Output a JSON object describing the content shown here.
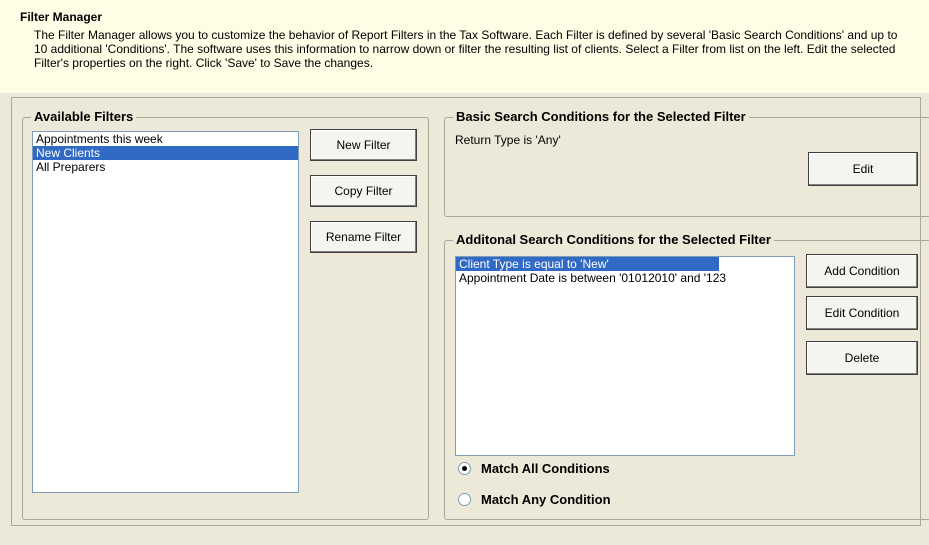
{
  "header": {
    "title": "Filter Manager",
    "description": "The Filter Manager allows you to customize the behavior of Report Filters in the Tax Software. Each Filter is defined by several 'Basic Search Conditions' and up to 10 additional 'Conditions'. The software uses this information to narrow down or filter the resulting list of clients. Select a Filter from list on the left. Edit the selected Filter's properties on the right. Click 'Save' to Save the changes."
  },
  "available_filters": {
    "title": "Available Filters",
    "items": [
      {
        "label": "Appointments this week",
        "selected": false
      },
      {
        "label": "New Clients",
        "selected": true
      },
      {
        "label": "All Preparers",
        "selected": false
      }
    ],
    "new_label": "New Filter",
    "copy_label": "Copy Filter",
    "rename_label": "Rename Filter"
  },
  "basic_conditions": {
    "title": "Basic Search Conditions for the Selected Filter",
    "text": "Return Type is 'Any'",
    "edit_label": "Edit"
  },
  "additional_conditions": {
    "title": "Additonal Search Conditions for the Selected Filter",
    "items": [
      {
        "label": "Client Type is equal to 'New'",
        "selected": true
      },
      {
        "label": "Appointment Date is between '01012010' and '123",
        "selected": false
      }
    ],
    "add_label": "Add Condition",
    "edit_label": "Edit Condition",
    "delete_label": "Delete",
    "match_all_label": "Match All Conditions",
    "match_any_label": "Match Any Condition",
    "match_mode": "all"
  },
  "colors": {
    "header_bg": "#fffde6",
    "window_bg": "#ece9d8",
    "selection": "#316ac5"
  }
}
